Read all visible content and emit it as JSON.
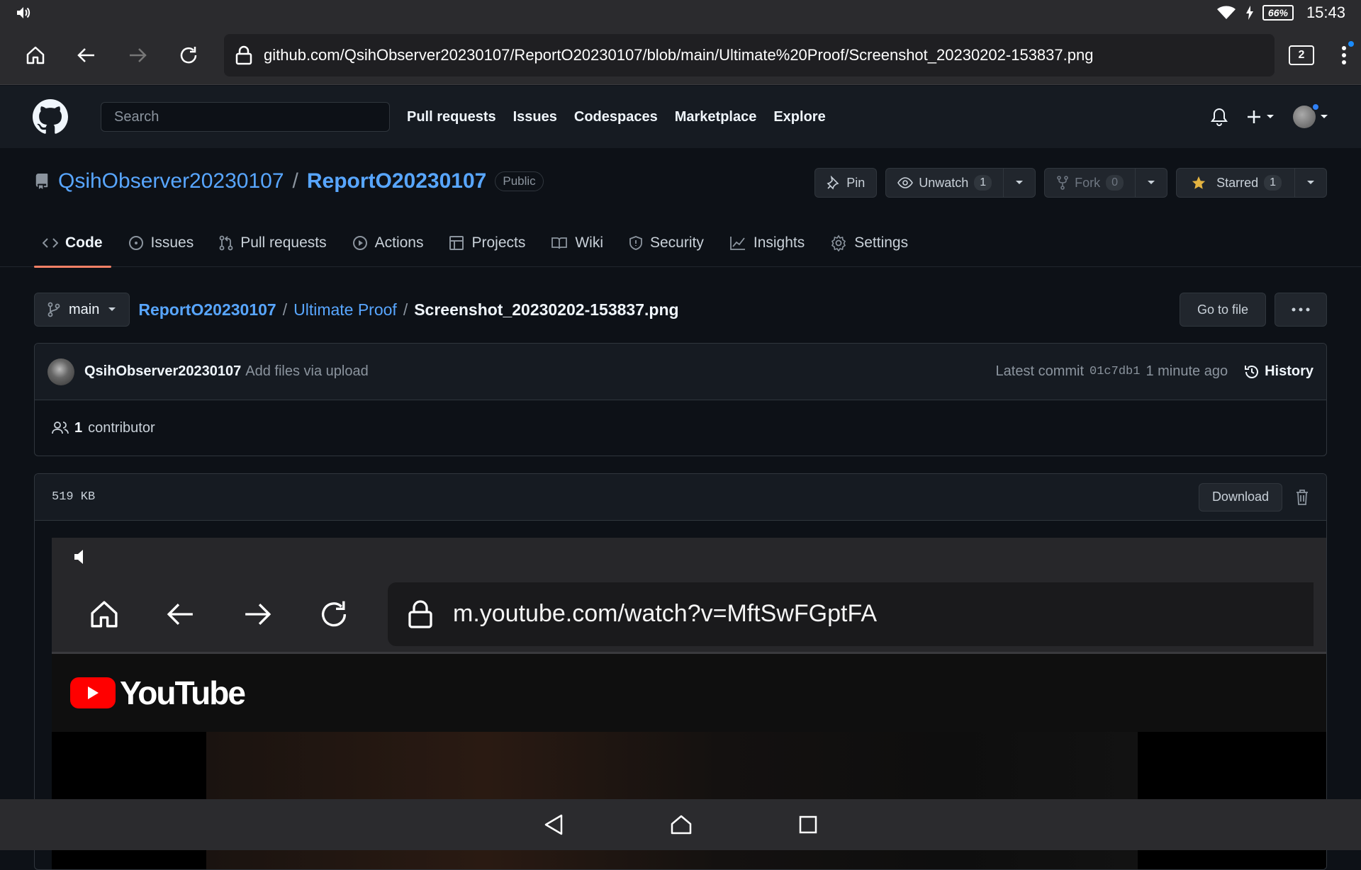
{
  "status_bar": {
    "battery": "66%",
    "time": "15:43",
    "icons": [
      "volume-icon",
      "wifi-icon",
      "charging-icon"
    ]
  },
  "browser": {
    "url": "github.com/QsihObserver20230107/ReportO20230107/blob/main/Ultimate%20Proof/Screenshot_20230202-153837.png",
    "tab_count": "2"
  },
  "gh_header": {
    "search_placeholder": "Search",
    "nav": [
      "Pull requests",
      "Issues",
      "Codespaces",
      "Marketplace",
      "Explore"
    ]
  },
  "repo": {
    "owner": "QsihObserver20230107",
    "separator": "/",
    "name": "ReportO20230107",
    "visibility": "Public",
    "pin_label": "Pin",
    "watch_label": "Unwatch",
    "watch_count": "1",
    "fork_label": "Fork",
    "fork_count": "0",
    "star_label": "Starred",
    "star_count": "1"
  },
  "repo_nav": [
    {
      "label": "Code",
      "icon": "code-icon"
    },
    {
      "label": "Issues",
      "icon": "issue-icon"
    },
    {
      "label": "Pull requests",
      "icon": "pull-request-icon"
    },
    {
      "label": "Actions",
      "icon": "play-icon"
    },
    {
      "label": "Projects",
      "icon": "table-icon"
    },
    {
      "label": "Wiki",
      "icon": "book-icon"
    },
    {
      "label": "Security",
      "icon": "shield-icon"
    },
    {
      "label": "Insights",
      "icon": "graph-icon"
    },
    {
      "label": "Settings",
      "icon": "gear-icon"
    }
  ],
  "breadcrumb": {
    "branch": "main",
    "repo": "ReportO20230107",
    "folder": "Ultimate Proof",
    "file": "Screenshot_20230202-153837.png",
    "sep": "/",
    "goto_label": "Go to file"
  },
  "commit": {
    "author": "QsihObserver20230107",
    "message": "Add files via upload",
    "latest_label": "Latest commit",
    "sha": "01c7db1",
    "when": "1 minute ago",
    "history_label": "History",
    "contrib_count": "1",
    "contrib_label": "contributor"
  },
  "file": {
    "size": "519  KB",
    "download_label": "Download"
  },
  "preview": {
    "url": "m.youtube.com/watch?v=MftSwFGptFA",
    "logo_text": "YouTube"
  },
  "colors": {
    "accent_link": "#58a6ff",
    "tab_underline": "#f78166",
    "star": "#e3b341",
    "youtube_red": "#ff0000"
  }
}
